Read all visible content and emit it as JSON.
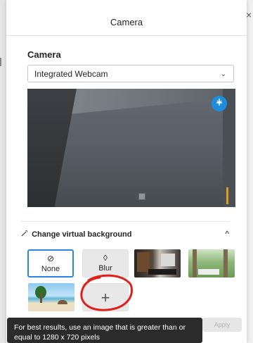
{
  "dialog": {
    "title": "Camera",
    "close_glyph": "×"
  },
  "camera": {
    "section_label": "Camera",
    "device_selected": "Integrated Webcam",
    "dropdown_icon": "chevron-down-icon",
    "preview_icon": "pin-icon"
  },
  "virtual_background": {
    "header": "Change virtual background",
    "header_icon": "magic-wand-icon",
    "toggle_icon": "chevron-up-icon",
    "toggle_glyph": "^",
    "options": [
      {
        "label": "None",
        "icon": "none-icon",
        "glyph": "⊘",
        "selected": true
      },
      {
        "label": "Blur",
        "icon": "blur-icon",
        "glyph": "◊",
        "selected": false
      },
      {
        "label": "",
        "icon": "office-background-image",
        "selected": false
      },
      {
        "label": "",
        "icon": "forest-background-image",
        "selected": false
      },
      {
        "label": "",
        "icon": "beach-background-image",
        "selected": false
      }
    ],
    "add_glyph": "+"
  },
  "tooltip": {
    "text": "For best results, use an image that is greater than or equal to 1280 x 720 pixels"
  },
  "footer": {
    "apply_label": "Apply"
  },
  "colors": {
    "accent": "#2b88d8",
    "annotation_circle": "#e0201b",
    "tooltip_bg": "#2b2b2b"
  }
}
